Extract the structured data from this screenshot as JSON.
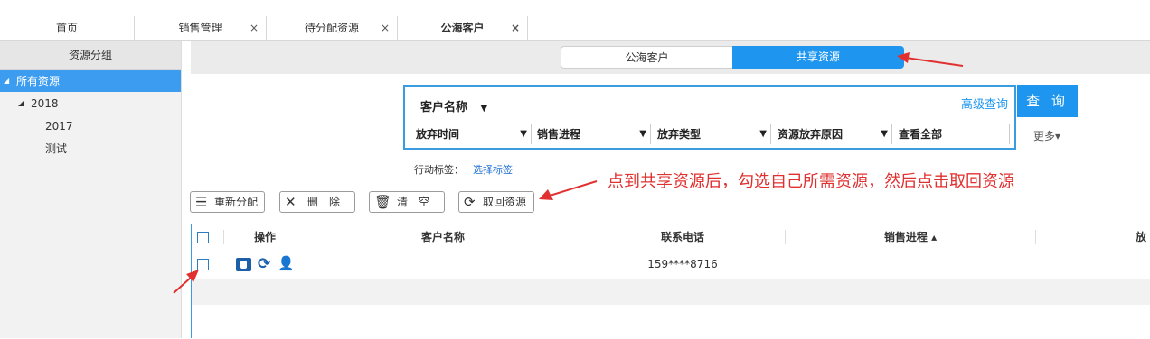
{
  "tabs": [
    {
      "label": "首页",
      "closable": false
    },
    {
      "label": "销售管理",
      "closable": true
    },
    {
      "label": "待分配资源",
      "closable": true
    },
    {
      "label": "公海客户",
      "closable": true
    }
  ],
  "close_glyph": "×",
  "sidebar": {
    "title": "资源分组",
    "tree": [
      {
        "label": "所有资源",
        "selected": true
      },
      {
        "label": "2018"
      },
      {
        "label": "2017"
      },
      {
        "label": "测试"
      }
    ]
  },
  "segment": {
    "items": [
      "公海客户",
      "共享资源"
    ],
    "active": 1
  },
  "search": {
    "field_label": "客户名称",
    "advanced_label": "高级查询",
    "button_label": "查 询",
    "filters": [
      "放弃时间",
      "销售进程",
      "放弃类型",
      "资源放弃原因",
      "查看全部"
    ],
    "more_label": "更多▾",
    "tag_label": "行动标签：",
    "tag_link": "选择标签"
  },
  "toolbar": {
    "reassign": "重新分配",
    "delete": "删　除",
    "clear": "清　空",
    "retrieve": "取回资源"
  },
  "grid": {
    "columns": [
      "操作",
      "客户名称",
      "联系电话",
      "销售进程 ▴",
      "放"
    ],
    "rows": [
      {
        "customer": "",
        "phone": "159****8716",
        "stage": ""
      }
    ]
  },
  "annotation": {
    "text": "点到共享资源后，勾选自己所需资源，然后点击取回资源",
    "color": "#e03030"
  },
  "colors": {
    "accent": "#1e96f0",
    "selection": "#3c9cf0",
    "annotation_red": "#e03030"
  }
}
